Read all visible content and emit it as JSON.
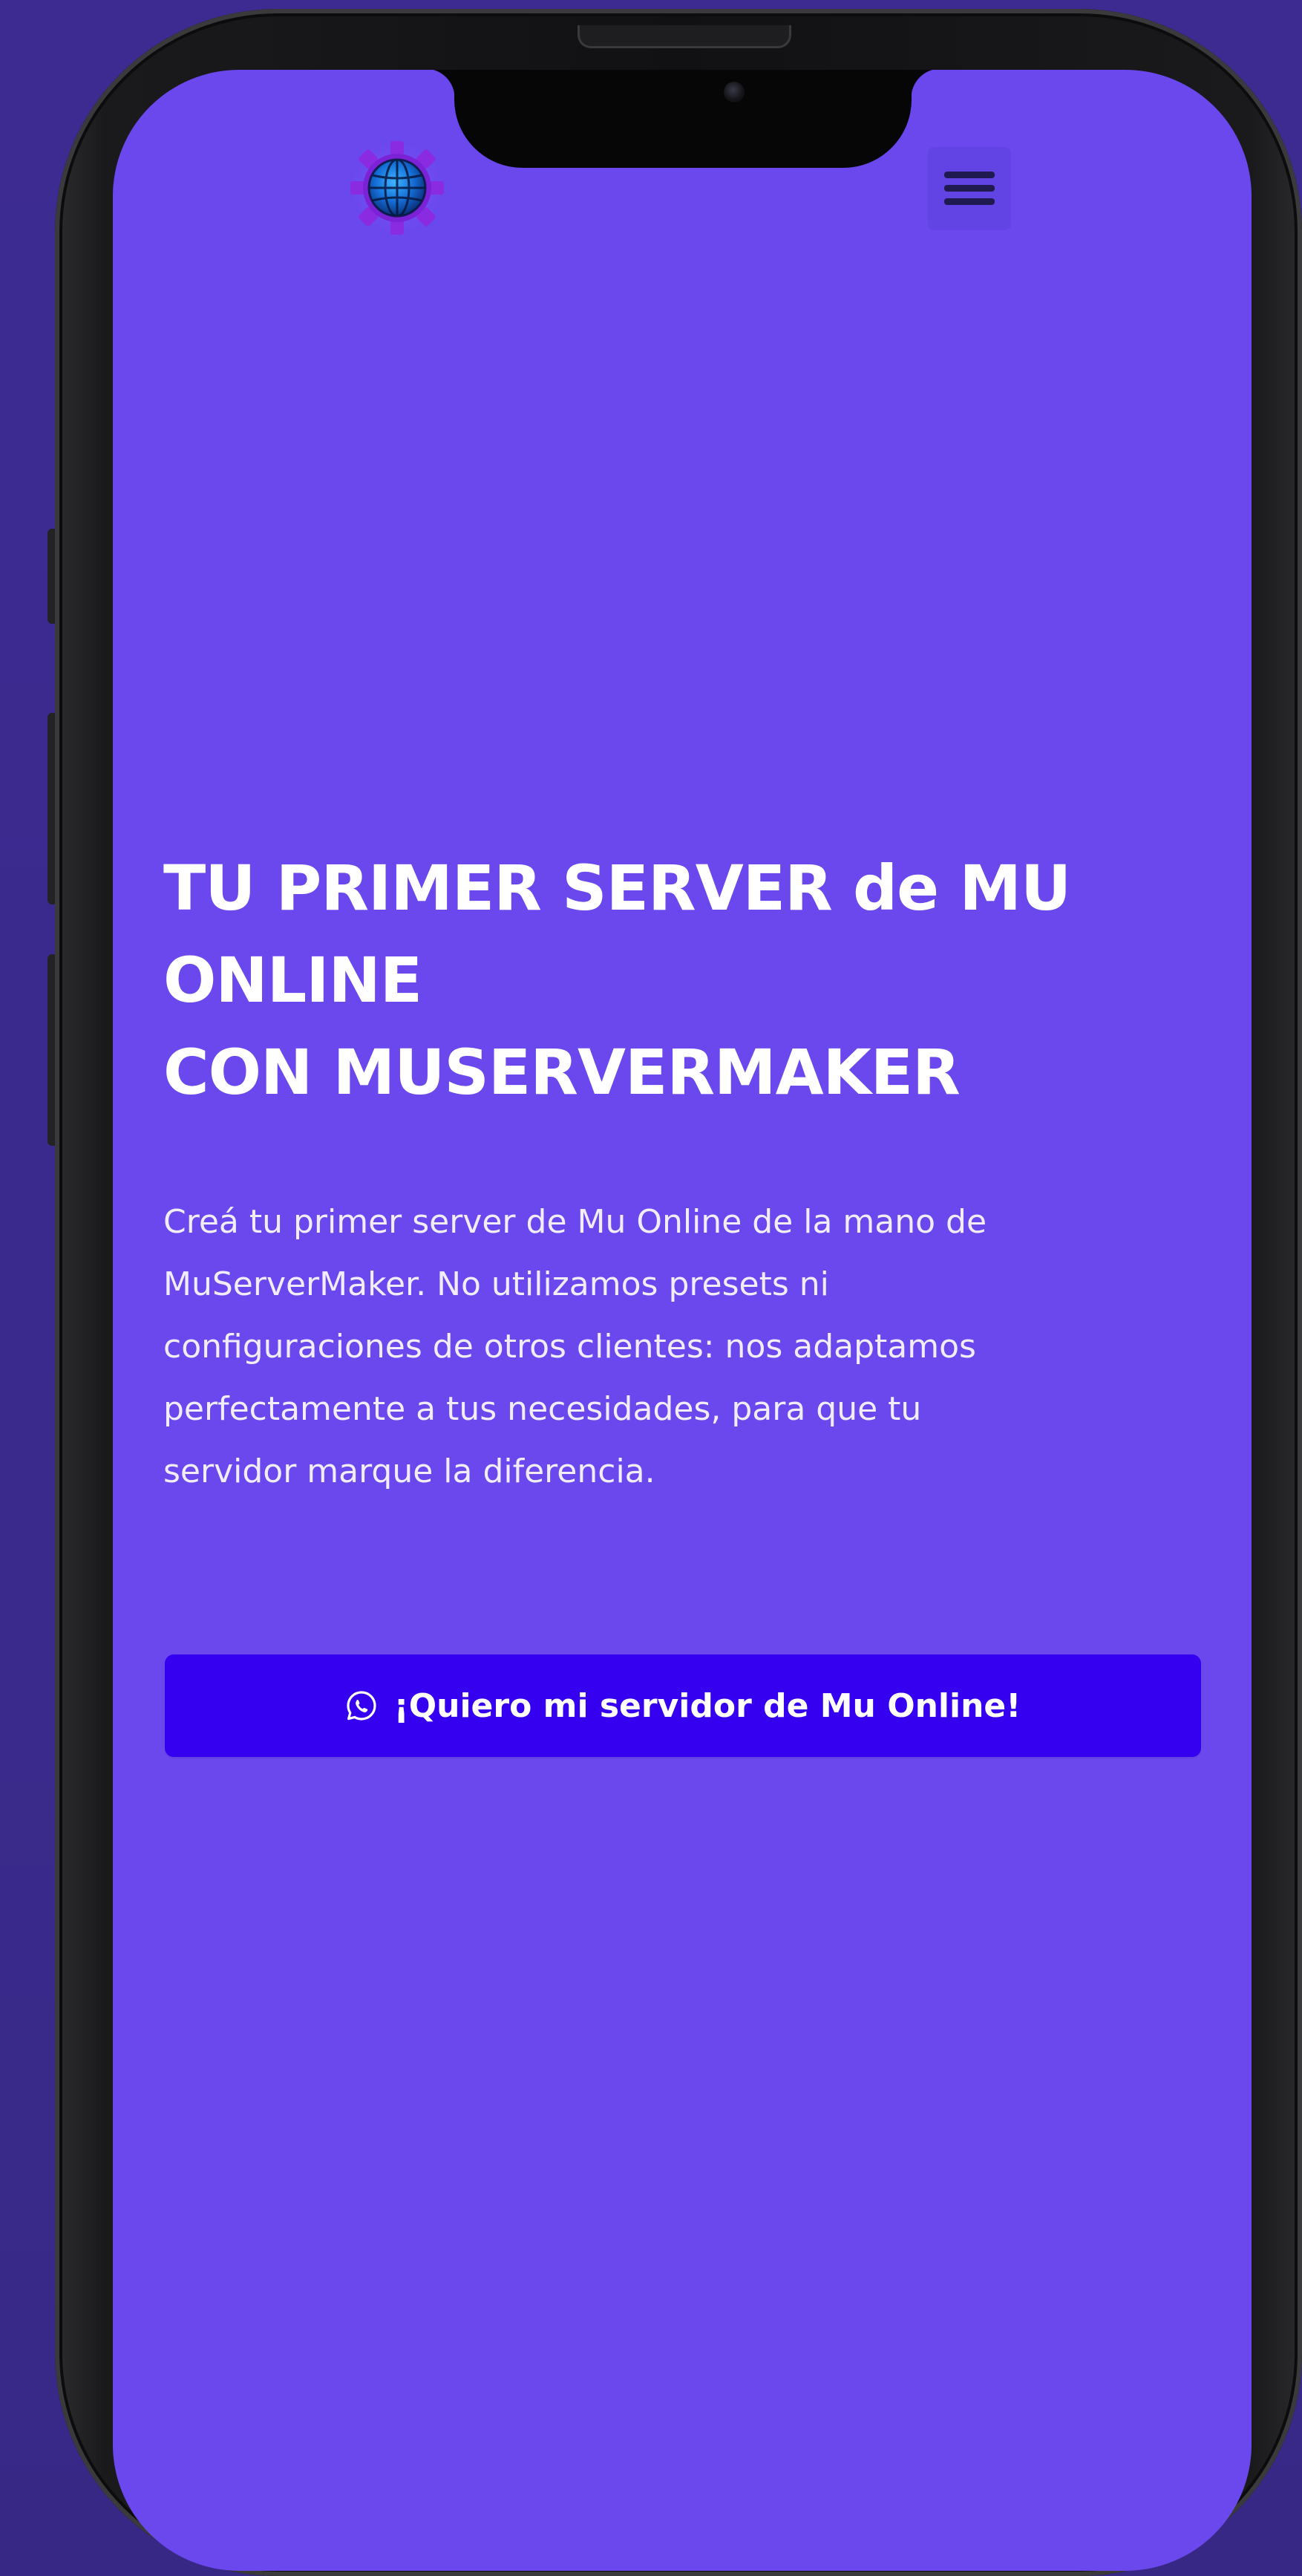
{
  "colors": {
    "page_background": "#3b2a8f",
    "screen_background": "#6a48ee",
    "menu_button_background": "#6243e4",
    "cta_background": "#3500f0",
    "text": "#ffffff"
  },
  "header": {
    "logo_icon": "gear-globe-logo-icon",
    "menu_icon": "hamburger-menu-icon"
  },
  "hero": {
    "title_line1": "TU PRIMER SERVER de MU",
    "title_line2": "ONLINE",
    "title_line3": "CON MUSERVERMAKER",
    "description_line1": "Creá tu primer server de Mu Online de la mano de",
    "description_line2": "MuServerMaker. No utilizamos presets ni",
    "description_line3": "configuraciones de otros clientes: nos adaptamos",
    "description_line4": "perfectamente a tus necesidades, para que tu",
    "description_line5": "servidor marque la diferencia."
  },
  "cta": {
    "icon": "whatsapp-icon",
    "label": "¡Quiero mi servidor de Mu Online!"
  }
}
